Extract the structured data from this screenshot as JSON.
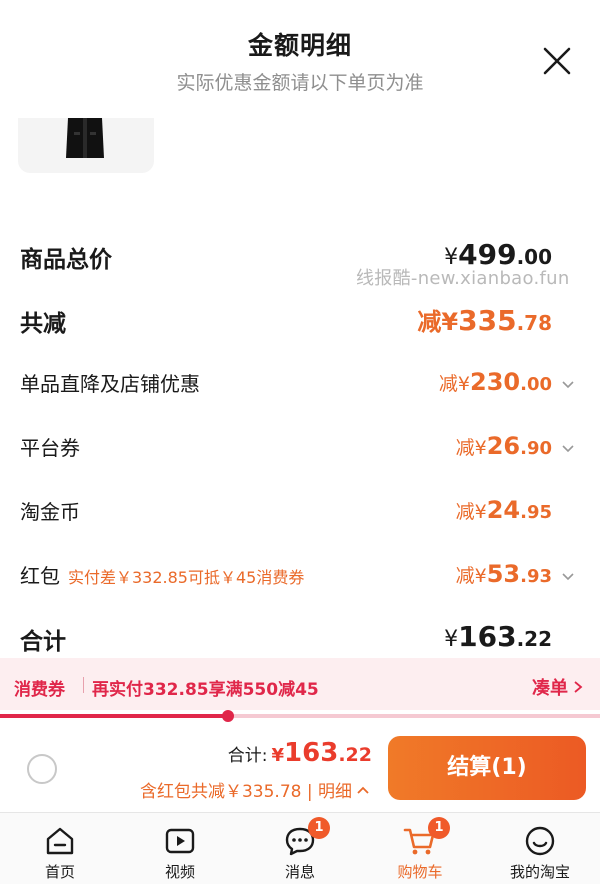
{
  "header": {
    "title": "金额明细",
    "subtitle": "实际优惠金额请以下单页为准"
  },
  "watermark": "线报酷-new.xianbao.fun",
  "summary": {
    "goods_total": {
      "label": "商品总价",
      "prefix": "¥",
      "int": "499",
      "dec": ".00"
    },
    "total_reduce": {
      "label": "共减",
      "prefix": "减¥",
      "int": "335",
      "dec": ".78"
    },
    "items": [
      {
        "label": "单品直降及店铺优惠",
        "prefix": "减¥",
        "int": "230",
        "dec": ".00",
        "has_chevron": true
      },
      {
        "label": "平台券",
        "prefix": "减¥",
        "int": "26",
        "dec": ".90",
        "has_chevron": true
      },
      {
        "label": "淘金币",
        "prefix": "减¥",
        "int": "24",
        "dec": ".95",
        "has_chevron": false
      },
      {
        "label": "红包",
        "note": "实付差￥332.85可抵￥45消费券",
        "prefix": "减¥",
        "int": "53",
        "dec": ".93",
        "has_chevron": true
      }
    ],
    "total": {
      "label": "合计",
      "prefix": "¥",
      "int": "163",
      "dec": ".22"
    }
  },
  "coupon_bar": {
    "tag": "消费券",
    "message": "再实付332.85享满550减45",
    "action": "凑单",
    "progress": 0.38
  },
  "checkout": {
    "total_label": "合计:",
    "prefix": "¥",
    "int": "163",
    "dec": ".22",
    "detail": "含红包共减￥335.78 | 明细",
    "pay_button": "结算(1)"
  },
  "tabbar": [
    {
      "label": "首页",
      "icon": "home-icon",
      "badge": ""
    },
    {
      "label": "视频",
      "icon": "video-icon",
      "badge": ""
    },
    {
      "label": "消息",
      "icon": "message-icon",
      "badge": "1"
    },
    {
      "label": "购物车",
      "icon": "cart-icon",
      "badge": "1",
      "active": true
    },
    {
      "label": "我的淘宝",
      "icon": "profile-icon",
      "badge": ""
    }
  ],
  "colors": {
    "accent_orange": "#ea6a2a",
    "accent_red": "#e0274a",
    "price_red": "#ea3c2c"
  }
}
